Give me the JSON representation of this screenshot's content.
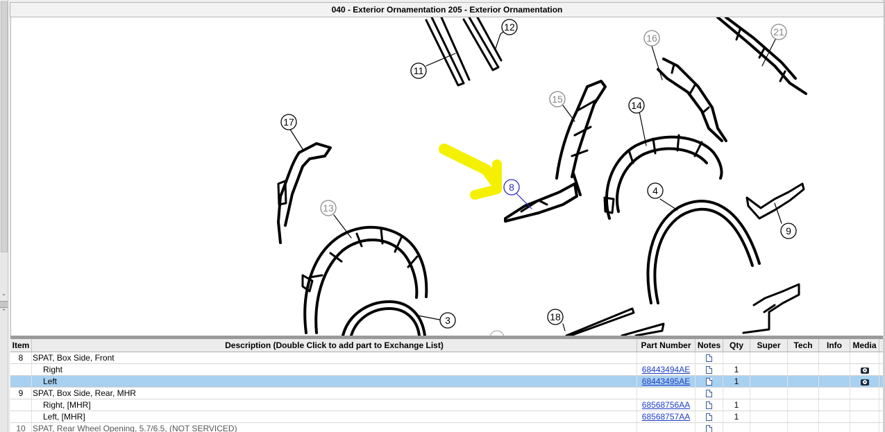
{
  "title": "040 - Exterior Ornamentation 205 - Exterior Ornamentation",
  "callouts": {
    "c11": "11",
    "c12": "12",
    "c16": "16",
    "c21": "21",
    "c15": "15",
    "c14": "14",
    "c17": "17",
    "c8": "8",
    "c4": "4",
    "c13": "13",
    "c9": "9",
    "c3": "3",
    "c18": "18"
  },
  "colors": {
    "highlight_arrow": "#f5f000",
    "selected_row": "#a8d0f0",
    "link": "#1a3cc8",
    "active_callout": "#2a2ac8"
  },
  "table": {
    "headers": {
      "item": "Item",
      "description": "Description (Double Click to add part to Exchange List)",
      "part_number": "Part Number",
      "notes": "Notes",
      "qty": "Qty",
      "super": "Super",
      "tech": "Tech",
      "info": "Info",
      "media": "Media"
    },
    "rows": [
      {
        "item": "8",
        "description": "SPAT, Box Side, Front",
        "part_number": "",
        "qty": "",
        "notes": true,
        "media": false
      },
      {
        "item": "",
        "description": "Right",
        "part_number": "68443494AE",
        "qty": "1",
        "notes": true,
        "media": true
      },
      {
        "item": "",
        "description": "Left",
        "part_number": "68443495AE",
        "qty": "1",
        "notes": true,
        "media": true,
        "selected": true
      },
      {
        "item": "9",
        "description": "SPAT, Box Side, Rear, MHR",
        "part_number": "",
        "qty": "",
        "notes": true,
        "media": false
      },
      {
        "item": "",
        "description": "Right, [MHR]",
        "part_number": "68568756AA",
        "qty": "1",
        "notes": true,
        "media": false
      },
      {
        "item": "",
        "description": "Left, [MHR]",
        "part_number": "68568757AA",
        "qty": "1",
        "notes": true,
        "media": false
      },
      {
        "item": "10",
        "description": "SPAT, Rear Wheel Opening, 5.7/6.5, (NOT SERVICED)",
        "part_number": "",
        "qty": "",
        "notes": true,
        "media": false
      }
    ]
  }
}
